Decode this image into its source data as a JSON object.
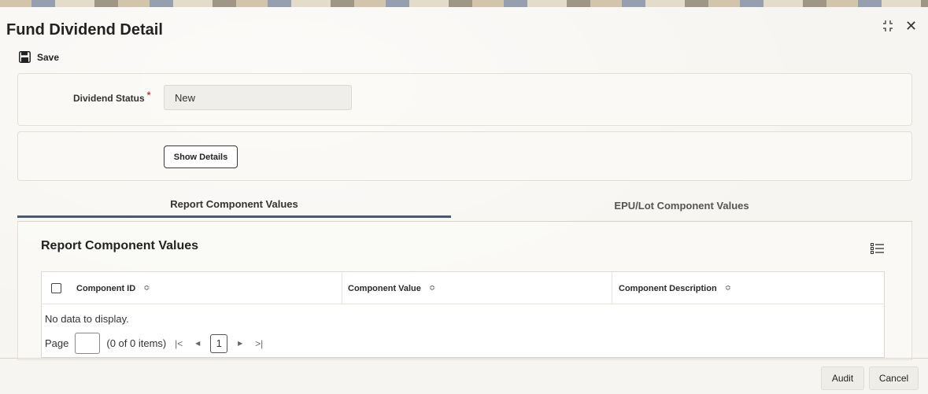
{
  "window": {
    "title": "Fund Dividend Detail"
  },
  "toolbar": {
    "save_label": "Save"
  },
  "form": {
    "dividend_status_label": "Dividend Status",
    "required_marker": "*",
    "dividend_status_value": "New",
    "show_details_label": "Show Details"
  },
  "tabs": [
    {
      "label": "Report Component Values",
      "active": true
    },
    {
      "label": "EPU/Lot Component Values",
      "active": false
    }
  ],
  "grid": {
    "title": "Report Component Values",
    "columns": [
      {
        "label": "Component ID",
        "sort": "≎"
      },
      {
        "label": "Component Value",
        "sort": "≎"
      },
      {
        "label": "Component Description",
        "sort": "≎"
      }
    ],
    "empty_text": "No data to display.",
    "pager": {
      "page_label": "Page",
      "items_text": "(0 of 0 items)",
      "first": "|<",
      "prev": "◀",
      "current": "1",
      "next": "▶",
      "last": ">|"
    }
  },
  "footer": {
    "audit_label": "Audit",
    "cancel_label": "Cancel"
  },
  "colors": {
    "active_tab_underline": "#4a5a6e",
    "required": "#d0302f"
  }
}
